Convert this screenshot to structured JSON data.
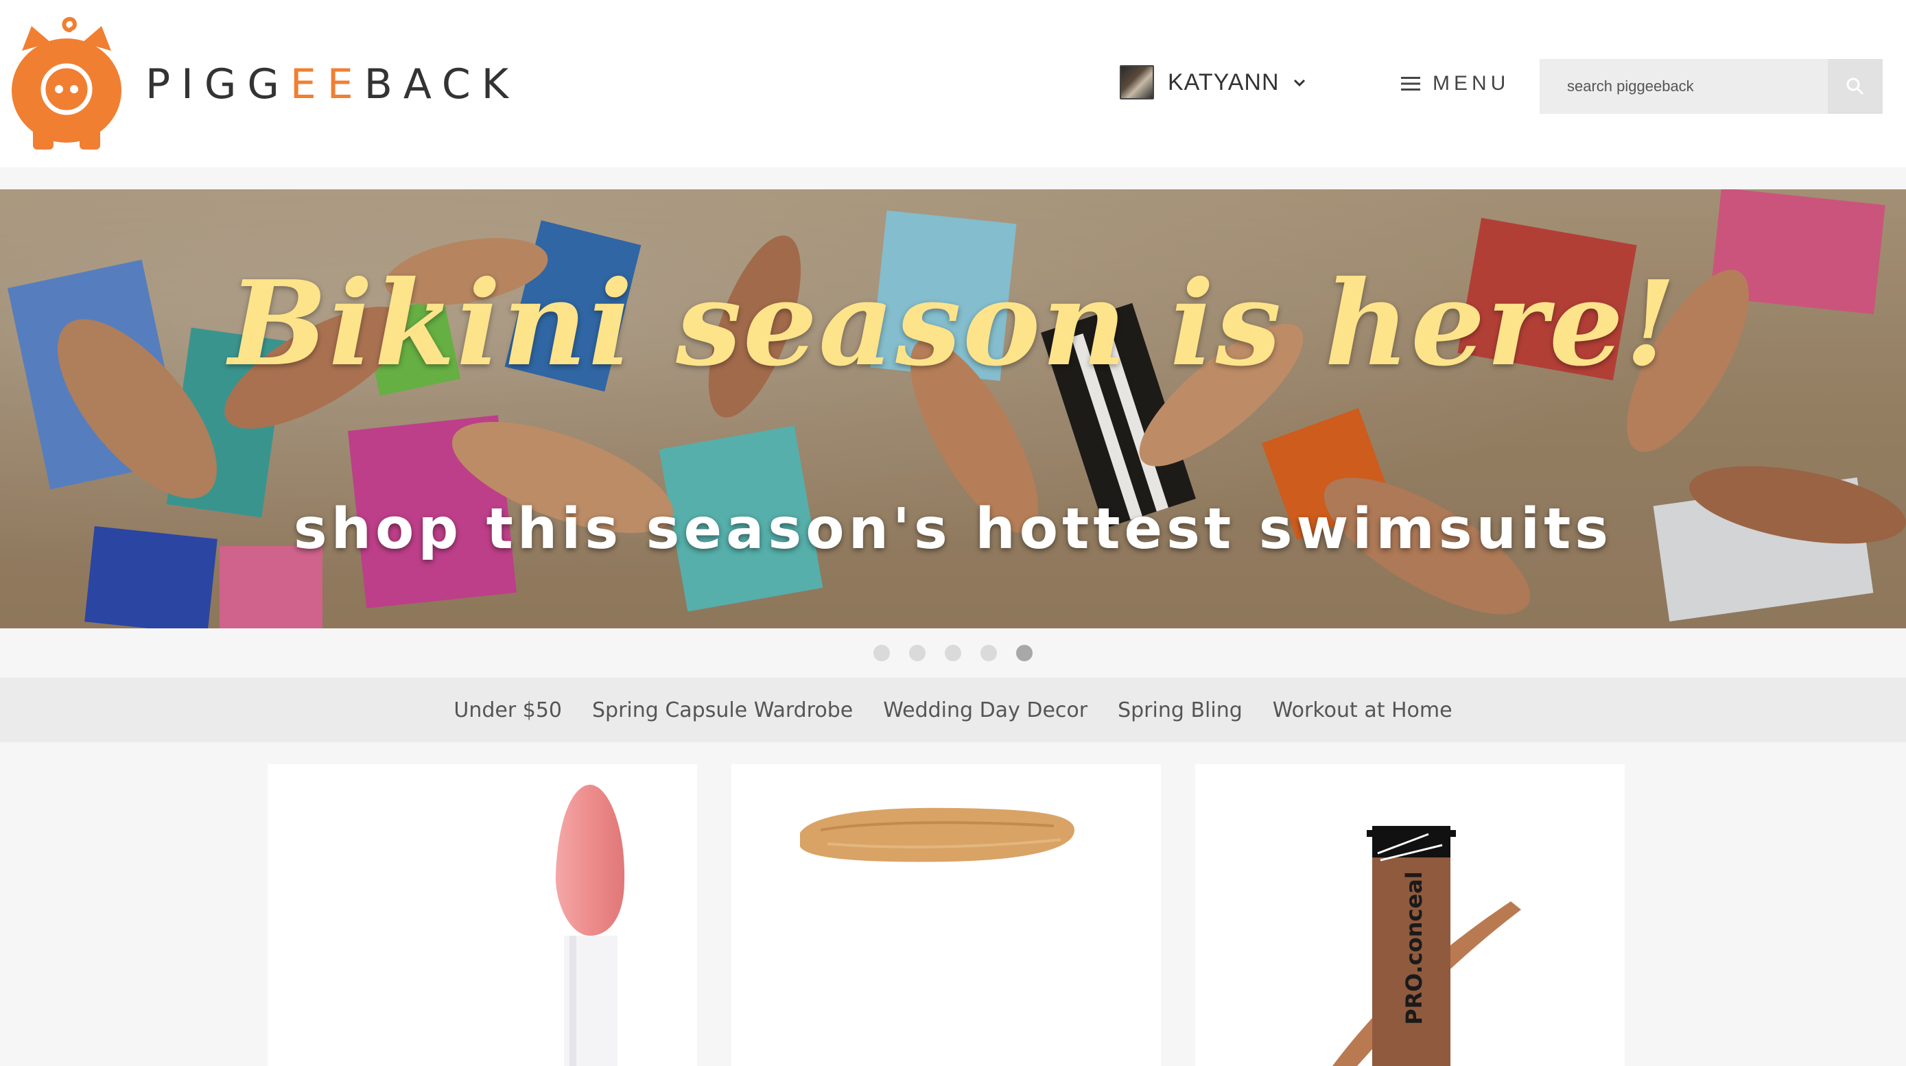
{
  "header": {
    "logo": {
      "text_prefix": "PIGG",
      "text_accent": "EE",
      "text_suffix": "BACK",
      "accent_color": "#f07f32"
    },
    "user": {
      "name": "KATYANN"
    },
    "menu": {
      "label": "MENU"
    },
    "search": {
      "placeholder": "search piggeeback"
    }
  },
  "hero": {
    "title": "Bikini season is here!",
    "subtitle": "shop this season's hottest swimsuits"
  },
  "carousel": {
    "active_index": 4,
    "count": 5
  },
  "categories": [
    "Under $50",
    "Spring Capsule Wardrobe",
    "Wedding Day Decor",
    "Spring Bling",
    "Workout at Home"
  ],
  "products": [
    {
      "icon": "lip-gloss-applicator-icon"
    },
    {
      "icon": "foundation-swatch-icon"
    },
    {
      "icon": "concealer-tube-icon",
      "tube_text": "PRO.conceal"
    }
  ],
  "colors": {
    "brand_orange": "#f07f32",
    "hero_title": "#fde38a"
  }
}
